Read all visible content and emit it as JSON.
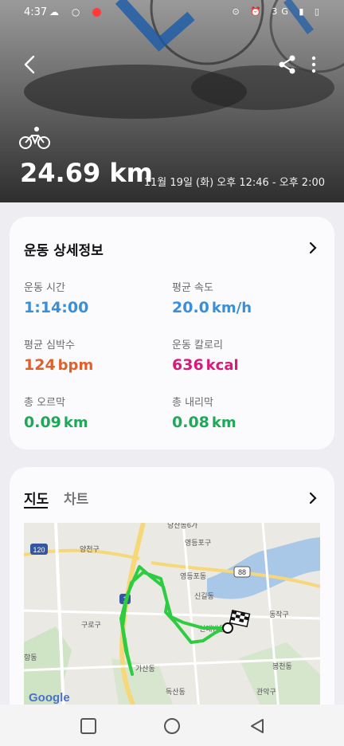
{
  "status_bar": {
    "time": "4:37",
    "network": "3G"
  },
  "header": {
    "distance": "24.69 km",
    "datetime": "11월 19일 (화) 오후 12:46 - 오후 2:00",
    "icons": [
      "back-arrow-icon",
      "share-icon",
      "more-vert-icon",
      "bicycle-icon"
    ]
  },
  "details": {
    "title": "운동 상세정보",
    "metrics": [
      {
        "label": "운동 시간",
        "value": "1:14:00",
        "unit": "",
        "color": "#3b8fd9"
      },
      {
        "label": "평균 속도",
        "value": "20.0",
        "unit": "km/h",
        "color": "#3b8fd9"
      },
      {
        "label": "평균 심박수",
        "value": "124",
        "unit": "bpm",
        "color": "#e0602a"
      },
      {
        "label": "운동 칼로리",
        "value": "636",
        "unit": "kcal",
        "color": "#d81b7a"
      },
      {
        "label": "총 오르막",
        "value": "0.09",
        "unit": "km",
        "color": "#1ea858"
      },
      {
        "label": "총 내리막",
        "value": "0.08",
        "unit": "km",
        "color": "#1ea858"
      }
    ]
  },
  "map_section": {
    "tabs": [
      "지도",
      "차트"
    ],
    "active_tab": "지도",
    "google_logo": "Google",
    "route_color": "#2ecc40",
    "map_labels": [
      "당산동6가",
      "양천구",
      "영등포구",
      "영등포동",
      "신길동",
      "구로구",
      "신대방동",
      "동작구",
      "가산동",
      "봉천동",
      "독산동",
      "관악구",
      "항동"
    ],
    "road_shields": [
      "120",
      "88",
      "1"
    ]
  }
}
